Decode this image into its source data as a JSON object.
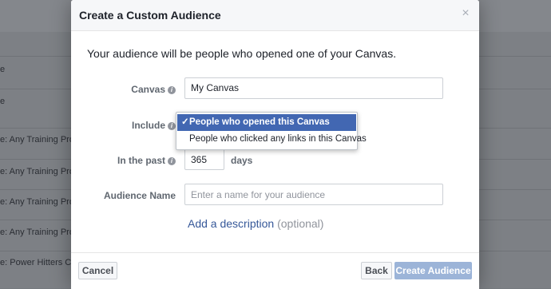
{
  "background": {
    "rows": [
      {
        "text": "e"
      },
      {
        "text": "e"
      },
      {
        "text": "e: Any Training Progr"
      },
      {
        "text": "e: Any Training Progr"
      },
      {
        "text": "e: Any Training Progr"
      },
      {
        "text": "e: Any Training Progr"
      },
      {
        "text": "e: Power Hitters Club"
      }
    ]
  },
  "dialog": {
    "title": "Create a Custom Audience",
    "close_glyph": "×",
    "intro": "Your audience will be people who opened one of your Canvas.",
    "canvas": {
      "label": "Canvas",
      "value": "My Canvas"
    },
    "include": {
      "label": "Include",
      "options": [
        {
          "label": "People who opened this Canvas",
          "selected": true
        },
        {
          "label": "People who clicked any links in this Canvas",
          "selected": false
        }
      ]
    },
    "in_the_past": {
      "label": "In the past",
      "value": "365",
      "unit": "days"
    },
    "audience_name": {
      "label": "Audience Name",
      "placeholder": "Enter a name for your audience"
    },
    "add_description": {
      "link": "Add a description",
      "optional": "(optional)"
    },
    "footer": {
      "cancel": "Cancel",
      "back": "Back",
      "create": "Create Audience"
    }
  },
  "info_icon_glyph": "i",
  "check_glyph": "✓",
  "colors": {
    "accent": "#4267b2",
    "link": "#365899",
    "disabled_button": "#9cb4d8"
  }
}
